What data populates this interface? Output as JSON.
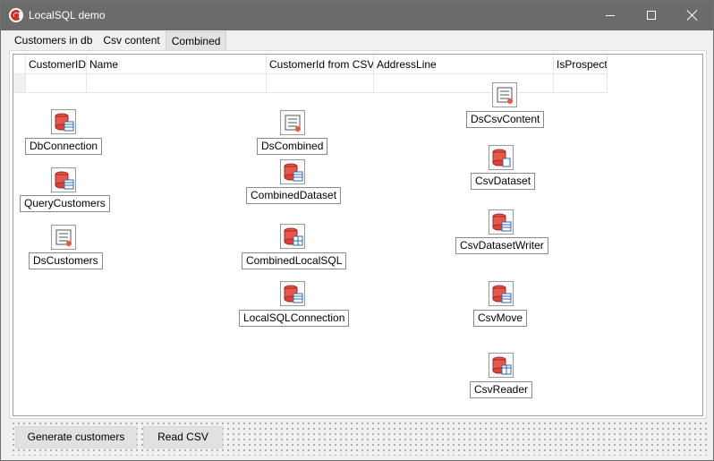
{
  "window": {
    "title": "LocalSQL demo",
    "buttons": {
      "minimize": "minimize-icon",
      "maximize": "maximize-icon",
      "close": "close-icon"
    }
  },
  "tabs": [
    {
      "label": "Customers in db",
      "active": false
    },
    {
      "label": "Csv content",
      "active": false
    },
    {
      "label": "Combined",
      "active": true
    }
  ],
  "grid": {
    "columns": [
      "CustomerID",
      "Name",
      "CustomerId from CSV",
      "AddressLine",
      "IsProspect"
    ],
    "rows": [
      [
        "",
        "",
        "",
        "",
        ""
      ]
    ]
  },
  "components": {
    "dbconnection": {
      "label": "DbConnection",
      "icon": "database-icon"
    },
    "querycustomers": {
      "label": "QueryCustomers",
      "icon": "database-table-icon"
    },
    "dscustomers": {
      "label": "DsCustomers",
      "icon": "datasource-icon"
    },
    "dscombined": {
      "label": "DsCombined",
      "icon": "datasource-icon"
    },
    "combineddataset": {
      "label": "CombinedDataset",
      "icon": "database-table-icon"
    },
    "combinedlocalsql": {
      "label": "CombinedLocalSQL",
      "icon": "database-grid-icon"
    },
    "localsqlconnection": {
      "label": "LocalSQLConnection",
      "icon": "database-table-icon"
    },
    "dscsvcontent": {
      "label": "DsCsvContent",
      "icon": "datasource-icon"
    },
    "csvdataset": {
      "label": "CsvDataset",
      "icon": "database-file-icon"
    },
    "csvdatasetwriter": {
      "label": "CsvDatasetWriter",
      "icon": "database-write-icon"
    },
    "csvmove": {
      "label": "CsvMove",
      "icon": "database-table-icon"
    },
    "csvreader": {
      "label": "CsvReader",
      "icon": "database-read-icon"
    }
  },
  "buttons": {
    "generate": "Generate customers",
    "read": "Read CSV"
  },
  "colors": {
    "titlebar": "#6b6b6b",
    "db_red": "#c8342b",
    "accent_blue": "#2b6cb0"
  }
}
